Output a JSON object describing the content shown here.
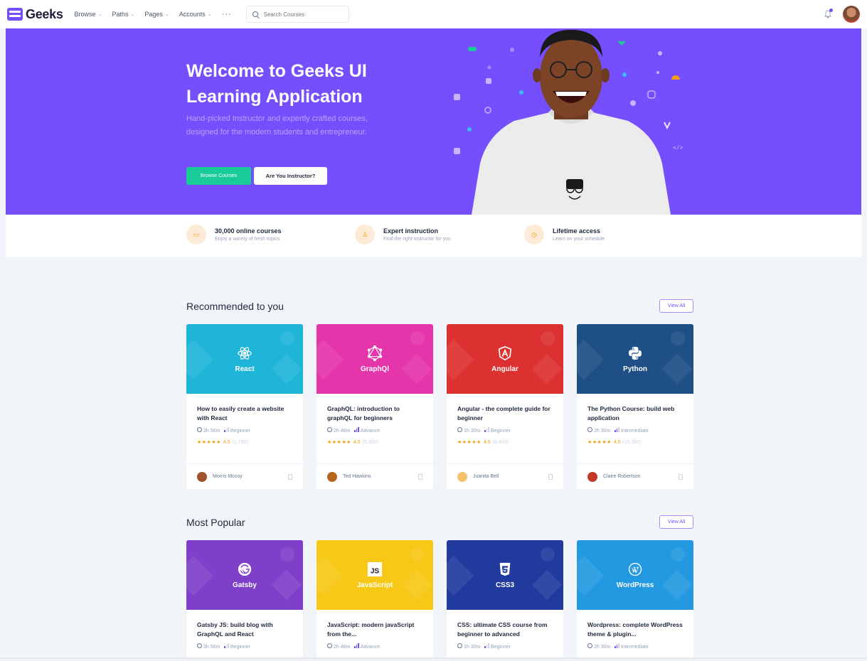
{
  "nav": {
    "brand": "Geeks",
    "menu": [
      "Browse",
      "Paths",
      "Pages",
      "Accounts"
    ],
    "more": "···",
    "search_placeholder": "Search Courses"
  },
  "hero": {
    "title": "Welcome to Geeks UI Learning Application",
    "subtitle": "Hand-picked Instructor and expertly crafted courses, designed for the modern students and entrepreneur.",
    "primary_btn": "Browse Courses",
    "secondary_btn": "Are You Instructor?",
    "colors": {
      "bg": "#754ffe",
      "primary": "#19cb98"
    }
  },
  "features": [
    {
      "icon": "video-icon",
      "title": "30,000 online courses",
      "desc": "Enjoy a variety of fresh topics"
    },
    {
      "icon": "user-icon",
      "title": "Expert instruction",
      "desc": "Find the right instructor for you"
    },
    {
      "icon": "clock-icon",
      "title": "Lifetime access",
      "desc": "Learn on your schedule"
    }
  ],
  "sections": [
    {
      "title": "Recommended to you",
      "view_all": "View All",
      "courses": [
        {
          "thumb": "React",
          "title": "How to easily create a website with React",
          "duration": "3h 56m",
          "level": "Beginner",
          "level_bars": 1,
          "rating": "4.5",
          "count": "(1,780)",
          "author": "Morris Mccoy",
          "color": "#1fb5d8",
          "icon": "react-icon"
        },
        {
          "thumb": "GraphQl",
          "title": "GraphQL: introduction to graphQL for beginners",
          "duration": "2h 46m",
          "level": "Advance",
          "level_bars": 3,
          "rating": "4.5",
          "count": "(5,300)",
          "author": "Ted Hawkins",
          "color": "#e535ab",
          "icon": "graphql-icon"
        },
        {
          "thumb": "Angular",
          "title": "Angular - the complete guide for beginner",
          "duration": "1h 30m",
          "level": "Beginner",
          "level_bars": 1,
          "rating": "4.5",
          "count": "(8,400)",
          "author": "Juanita Bell",
          "color": "#dd3131",
          "icon": "angular-icon"
        },
        {
          "thumb": "Python",
          "title": "The Python Course: build web application",
          "duration": "2h 30m",
          "level": "Intermediate",
          "level_bars": 2,
          "rating": "4.5",
          "count": "(15,380)",
          "author": "Claire Robertson",
          "color": "#1e4f85",
          "icon": "python-icon"
        }
      ]
    },
    {
      "title": "Most Popular",
      "view_all": "View All",
      "courses": [
        {
          "thumb": "Gatsby",
          "title": "Gatsby JS: build blog with GraphQL and React",
          "duration": "3h 56m",
          "level": "Beginner",
          "level_bars": 1,
          "color": "#7e3fc9",
          "icon": "gatsby-icon"
        },
        {
          "thumb": "JavaScript",
          "title": "JavaScript: modern javaScript from the...",
          "duration": "2h 46m",
          "level": "Advance",
          "level_bars": 3,
          "color": "#f7c815",
          "icon": "js-icon"
        },
        {
          "thumb": "CSS3",
          "title": "CSS: ultimate CSS course from beginner to advanced",
          "duration": "1h 30m",
          "level": "Beginner",
          "level_bars": 1,
          "color": "#213a9e",
          "icon": "css3-icon"
        },
        {
          "thumb": "WordPress",
          "title": "Wordpress: complete WordPress theme & plugin...",
          "duration": "2h 30m",
          "level": "Intermediate",
          "level_bars": 2,
          "color": "#2299e0",
          "icon": "wordpress-icon"
        }
      ]
    }
  ]
}
